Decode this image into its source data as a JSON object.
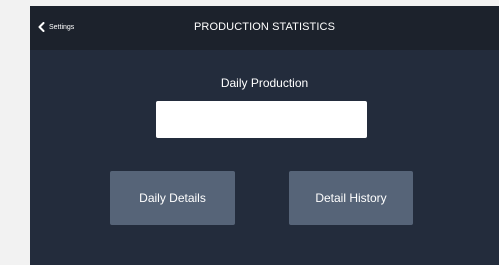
{
  "header": {
    "back_label": "Settings",
    "title": "PRODUCTION STATISTICS"
  },
  "main": {
    "section_label": "Daily Production",
    "daily_production_value": "",
    "buttons": {
      "daily_details": "Daily Details",
      "detail_history": "Detail History"
    }
  },
  "icons": {
    "back": "chevron-left-icon"
  },
  "colors": {
    "background": "#232c3c",
    "header": "#1c222c",
    "button": "#566478",
    "text": "#ffffff"
  }
}
